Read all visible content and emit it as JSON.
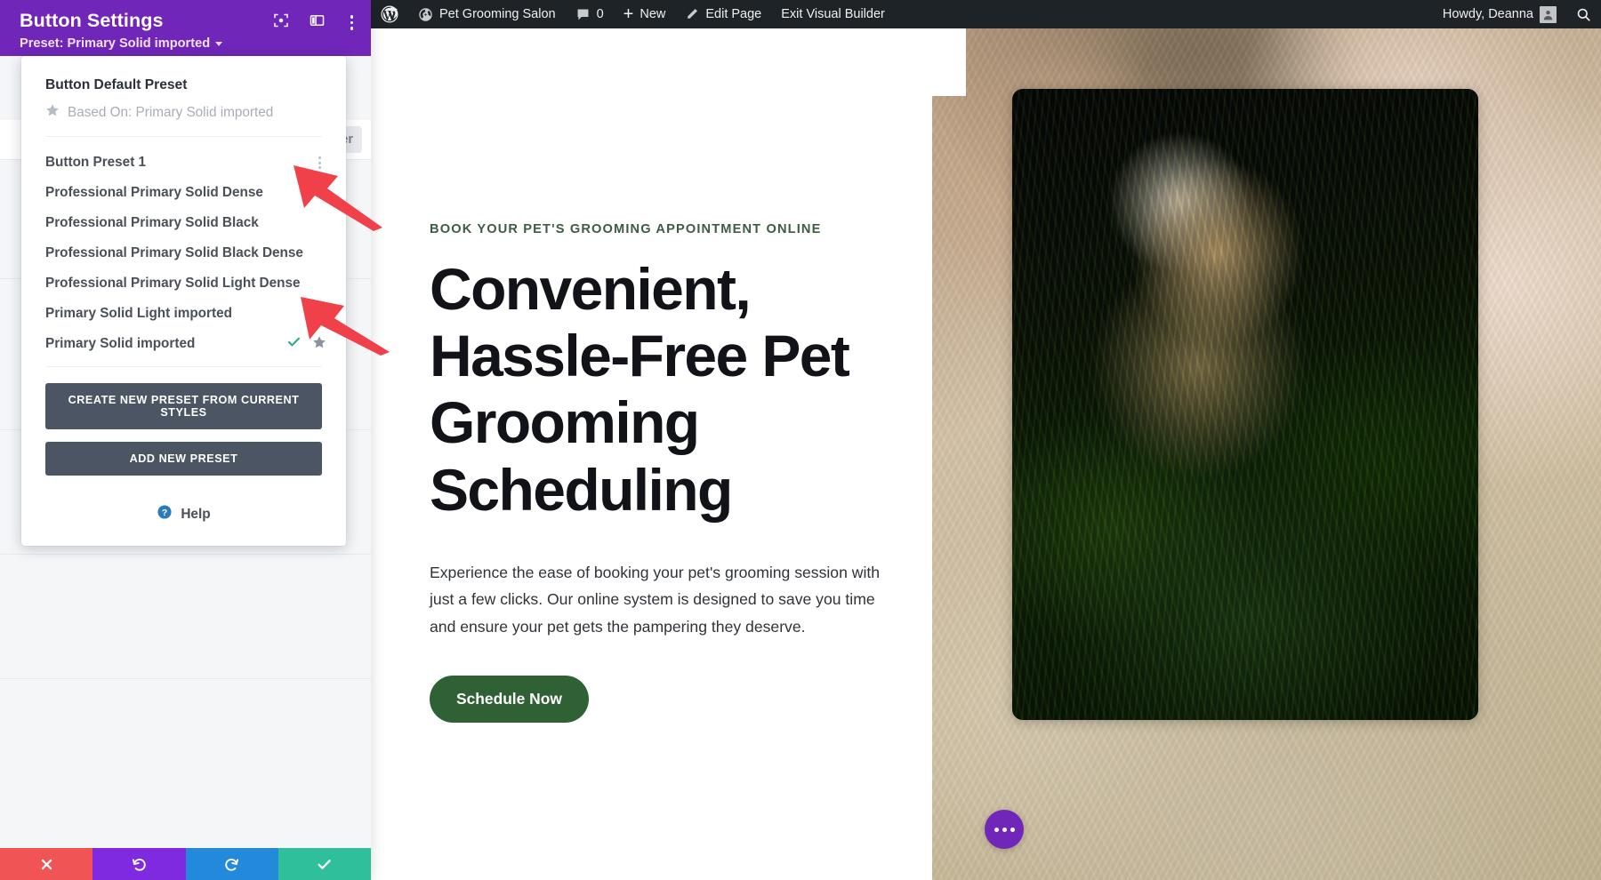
{
  "adminbar": {
    "wp_logo": "wordpress-logo-icon",
    "site_name": "Pet Grooming Salon",
    "comments_count": "0",
    "new_label": "New",
    "edit_page_label": "Edit Page",
    "exit_builder_label": "Exit Visual Builder",
    "howdy": "Howdy, Deanna",
    "search_icon": "search-icon"
  },
  "panel": {
    "title": "Button Settings",
    "subtitle": "Preset: Primary Solid imported",
    "ghost_tab": "er",
    "header_icons": [
      "focus-target-icon",
      "layout-columns-icon",
      "kebab-menu-icon"
    ],
    "footer": {
      "cancel": "close-icon",
      "undo": "undo-icon",
      "redo": "redo-icon",
      "save": "check-icon"
    },
    "footer_colors": {
      "cancel": "#f05454",
      "undo": "#7f2ae0",
      "redo": "#2389da",
      "save": "#30bf9b"
    },
    "accent": "#7026b9"
  },
  "preset_dropdown": {
    "default_title": "Button Default Preset",
    "default_based_on": "Based On: Primary Solid imported",
    "items": [
      {
        "label": "Button Preset 1",
        "has_kebab": true,
        "is_active": false,
        "is_default": false
      },
      {
        "label": "Professional Primary Solid Dense",
        "has_kebab": false,
        "is_active": false,
        "is_default": false
      },
      {
        "label": "Professional Primary Solid Black",
        "has_kebab": false,
        "is_active": false,
        "is_default": false
      },
      {
        "label": "Professional Primary Solid Black Dense",
        "has_kebab": false,
        "is_active": false,
        "is_default": false
      },
      {
        "label": "Professional Primary Solid Light Dense",
        "has_kebab": false,
        "is_active": false,
        "is_default": false
      },
      {
        "label": "Primary Solid Light imported",
        "has_kebab": false,
        "is_active": false,
        "is_default": false
      },
      {
        "label": "Primary Solid imported",
        "has_kebab": false,
        "is_active": true,
        "is_default": true
      }
    ],
    "create_button": "CREATE NEW PRESET FROM CURRENT STYLES",
    "add_button": "ADD NEW PRESET",
    "help_label": "Help",
    "help_icon": "help-circle-icon",
    "active_check_color": "#2aa98a",
    "star_color": "#8a939e"
  },
  "page": {
    "eyebrow": "BOOK YOUR PET'S GROOMING APPOINTMENT ONLINE",
    "heading": "Convenient, Hassle-Free Pet Grooming Scheduling",
    "paragraph": "Experience the ease of booking your pet's grooming session with just a few clicks. Our online system is designed to save you time and ensure your pet gets the pampering they deserve.",
    "cta_label": "Schedule Now",
    "cta_color": "#2f6134",
    "eyebrow_color": "#3e5b43",
    "fab_icon": "ellipsis-icon",
    "fab_color": "#7026b9",
    "hero_image": "cat-in-grass-photo",
    "background_image": "cat-fur-closeup-photo"
  },
  "annotations": {
    "arrow_color": "#f0404a",
    "arrows": [
      {
        "name": "arrow-pointing-to-button-preset-1"
      },
      {
        "name": "arrow-pointing-to-primary-solid-imported"
      }
    ]
  }
}
